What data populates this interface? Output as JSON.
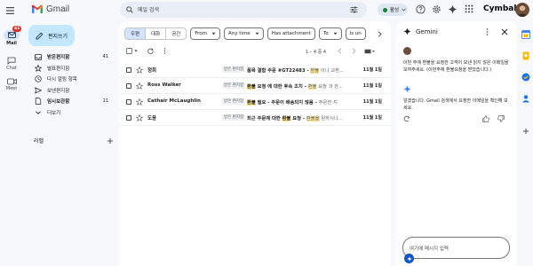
{
  "app": {
    "title": "Gmail"
  },
  "search": {
    "placeholder": "메일 검색"
  },
  "status": {
    "label": "활성"
  },
  "brand": {
    "name": "Cymbal"
  },
  "rail": {
    "mail_label": "Mail",
    "mail_badge": "41",
    "chat_label": "Chat",
    "meet_label": "Meet"
  },
  "compose": {
    "label": "편지쓰기"
  },
  "nav": {
    "items": [
      {
        "label": "받은편지함",
        "count": "41",
        "icon": "inbox-icon",
        "bold": true
      },
      {
        "label": "별표편지함",
        "count": "",
        "icon": "star-icon",
        "bold": false
      },
      {
        "label": "다시 알림 항목",
        "count": "",
        "icon": "clock-icon",
        "bold": false
      },
      {
        "label": "보낸편지함",
        "count": "",
        "icon": "send-icon",
        "bold": false
      },
      {
        "label": "임시보관함",
        "count": "11",
        "icon": "draft-icon",
        "bold": true
      },
      {
        "label": "더보기",
        "count": "",
        "icon": "chevron-down-icon",
        "bold": false
      }
    ]
  },
  "labels": {
    "title": "라벨"
  },
  "filters": {
    "segments": [
      "우편",
      "대화",
      "공간"
    ],
    "active_segment": "우편",
    "chips": [
      "From",
      "Any time",
      "Has attachment",
      "To",
      "Is un"
    ]
  },
  "toolbar": {
    "pager": "1 – 4 중 4"
  },
  "emails": [
    {
      "sender": "정희",
      "chip": "받은 편지함",
      "pre": "",
      "subject_a": "품목 결함 주문 #GT22483 - ",
      "hl1": "",
      "mid": "",
      "snippet_a": "",
      "hl2": "환불",
      "snippet_b": " 이나 교환...",
      "date": "11월 1일"
    },
    {
      "sender": "Ross Walker",
      "chip": "받은 편지함",
      "pre": "",
      "subject_a": "",
      "hl1": "환불",
      "mid": " 요청 에 대한 후속 조치 - ",
      "snippet_a": "",
      "hl2": "환불",
      "snippet_b": " 요청 과 관...",
      "date": "11월 1일"
    },
    {
      "sender": "Cathair McLaughlin",
      "chip": "받은 편지함",
      "pre": "",
      "subject_a": "",
      "hl1": "환불",
      "mid": " 필요 - 주문이 배송되지 않음 - ",
      "snippet_a": "주문한 지",
      "hl2": "",
      "snippet_b": "",
      "date": "11월 1일"
    },
    {
      "sender": "도윤",
      "chip": "받은 편지함",
      "pre": "",
      "subject_a": "최근 주문에 대한 ",
      "hl1": "환불",
      "mid": " 요청 - ",
      "snippet_a": "",
      "hl2": "환불을",
      "snippet_b": " 원하시나...",
      "date": "11월 1일"
    }
  ],
  "gemini": {
    "title": "Gemini",
    "prompt": "이번 주에 환불을 요청한 고객이 보낸 읽지 않은 이메일을 보여주세요. (이번주에 환불요청을 받았습니다.)",
    "answer": "알겠습니다. Gmail 검색에서 요청한 이메일을 확인해 보세요.",
    "input_placeholder": "여기에 메시지 입력"
  },
  "colors": {
    "accent": "#0b57d0",
    "highlight": "#fde293",
    "compose_bg": "#c2e7ff",
    "selected_bg": "#d3e3fd",
    "badge": "#d93025",
    "status_green": "#188038"
  }
}
